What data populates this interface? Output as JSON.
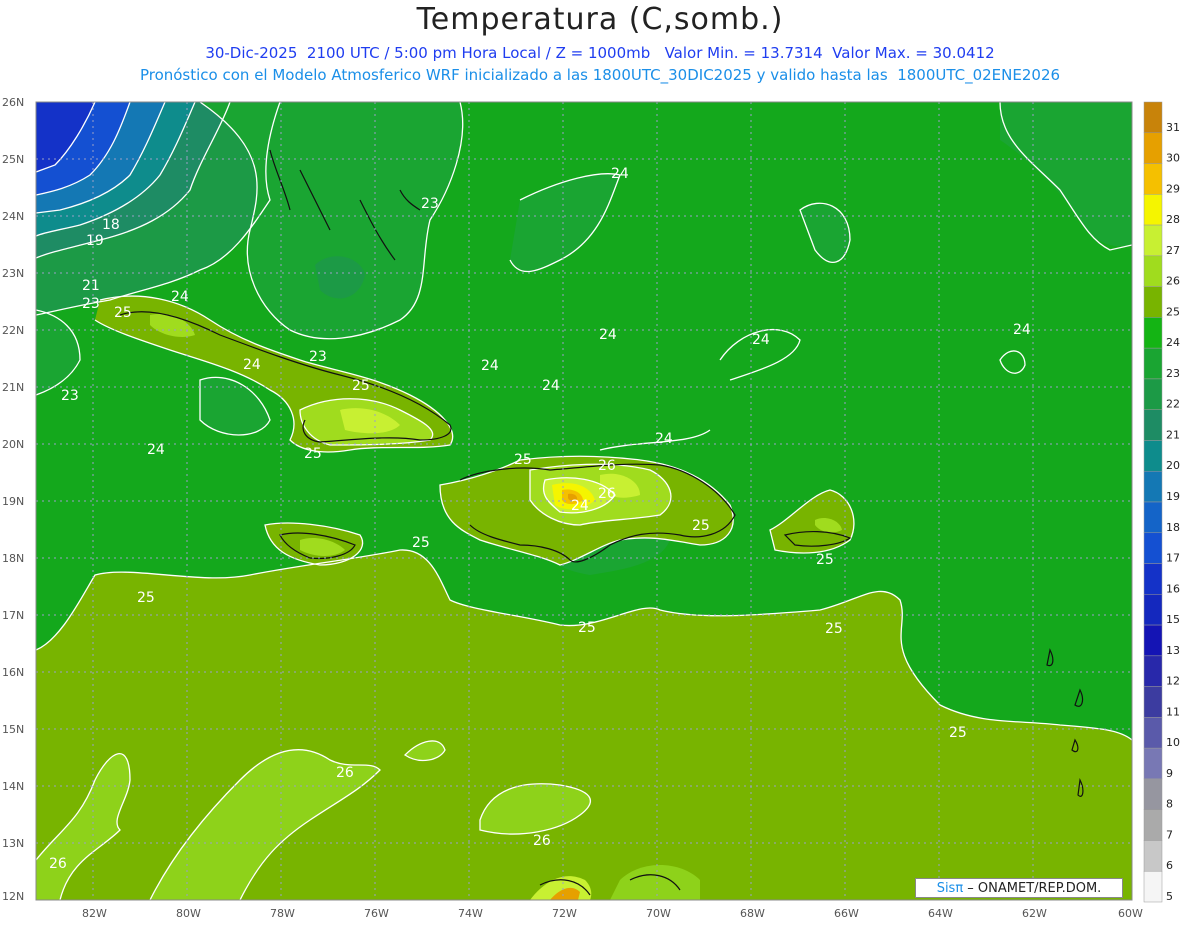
{
  "header": {
    "title": "Temperatura (C,somb.)",
    "line1": "30-Dic-2025  2100 UTC / 5:00 pm Hora Local / Z = 1000mb   Valor Min. = 13.7314  Valor Max. = 30.0412",
    "line2": "Pronóstico con el Modelo Atmosferico WRF inicializado a las 1800UTC_30DIC2025 y valido hasta las  1800UTC_02ENE2026"
  },
  "axes": {
    "lat_labels": [
      "26N",
      "25N",
      "24N",
      "23N",
      "22N",
      "21N",
      "20N",
      "19N",
      "18N",
      "17N",
      "16N",
      "15N",
      "14N",
      "13N",
      "12N"
    ],
    "lon_labels": [
      "82W",
      "80W",
      "78W",
      "76W",
      "74W",
      "72W",
      "70W",
      "68W",
      "66W",
      "64W",
      "62W",
      "60W"
    ]
  },
  "colorbar": {
    "levels": [
      "31",
      "30",
      "29",
      "28",
      "27",
      "26",
      "25",
      "24",
      "23",
      "22",
      "21",
      "20",
      "19",
      "18",
      "17",
      "16",
      "15",
      "13",
      "12",
      "11",
      "10",
      "9",
      "8",
      "7",
      "6",
      "5"
    ],
    "colors": [
      "#c8830a",
      "#e6a000",
      "#f5c000",
      "#f5f500",
      "#c8f032",
      "#a0dc1e",
      "#78b400",
      "#14b414",
      "#1aa532",
      "#1c9a46",
      "#1e8c64",
      "#0e8c8c",
      "#1478b4",
      "#1464c8",
      "#1450d2",
      "#1432c8",
      "#1428be",
      "#1414b4",
      "#2828aa",
      "#3c3ca0",
      "#5a5aaa",
      "#7878b4",
      "#9696a0",
      "#aaaaaa",
      "#c8c8c8",
      "#f5f5f5"
    ]
  },
  "contour_labels": [
    {
      "text": "18"
    },
    {
      "text": "19"
    },
    {
      "text": "21"
    },
    {
      "text": "23"
    },
    {
      "text": "25"
    },
    {
      "text": "24"
    },
    {
      "text": "23"
    },
    {
      "text": "23"
    },
    {
      "text": "24"
    },
    {
      "text": "25"
    },
    {
      "text": "24"
    },
    {
      "text": "25"
    },
    {
      "text": "24"
    },
    {
      "text": "24"
    },
    {
      "text": "24"
    },
    {
      "text": "24"
    },
    {
      "text": "24"
    },
    {
      "text": "24"
    },
    {
      "text": "24"
    },
    {
      "text": "25"
    },
    {
      "text": "26"
    },
    {
      "text": "26"
    },
    {
      "text": "25"
    },
    {
      "text": "25"
    },
    {
      "text": "25"
    },
    {
      "text": "25"
    },
    {
      "text": "25"
    },
    {
      "text": "25"
    },
    {
      "text": "25"
    },
    {
      "text": "26"
    },
    {
      "text": "26"
    },
    {
      "text": "26"
    },
    {
      "text": "23"
    },
    {
      "text": "24"
    }
  ],
  "credit": {
    "brand": "Sisπ",
    "rest": " – ONAMET/REP.DOM."
  }
}
